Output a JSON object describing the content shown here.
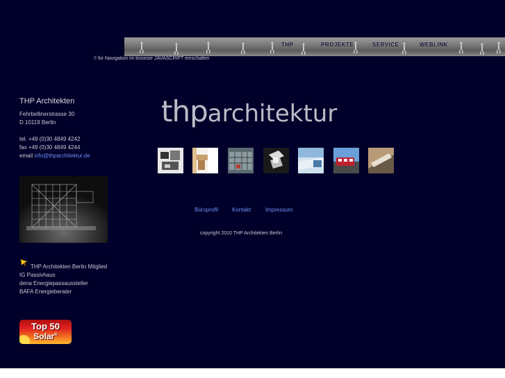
{
  "nav": {
    "items": [
      {
        "label": "THP"
      },
      {
        "label": "PROJEKTE"
      },
      {
        "label": "SERVICE"
      },
      {
        "label": "WEBLINK"
      }
    ]
  },
  "js_notice": "!! für Navigation im browser JAVASCRIPT einschalten",
  "contact": {
    "company": "THP Architekten",
    "street": "Fehrbellinerstrasse 30",
    "city": "D  10119  Berlin",
    "phone": "tel. +49 (0)30 4849 4242",
    "fax": "fax +49 (0)30 4849 4244",
    "email_prefix": "email ",
    "email": "info@thparchitektur.de"
  },
  "membership": {
    "line1": "THP Architekten Berlin Mitglied",
    "line2": "IG Passivhaus",
    "line3": "dena Energiepassaussteller",
    "line4": "BAFA Energieberater"
  },
  "logo": {
    "part1": "thp",
    "part2": "architektur"
  },
  "footer": {
    "links": [
      {
        "label": "Büroprofil"
      },
      {
        "label": "Kontakt"
      },
      {
        "label": "Impressum"
      }
    ],
    "copyright": "copyright 2010 THP Architekten Berlin"
  },
  "badge": {
    "line1": "Top 50",
    "line2": "Solar",
    "mark": "®"
  },
  "colors": {
    "background": "#00002a",
    "link": "#6f8ef5",
    "text": "#c8c8d0"
  },
  "icons": [
    "pin-icon"
  ]
}
